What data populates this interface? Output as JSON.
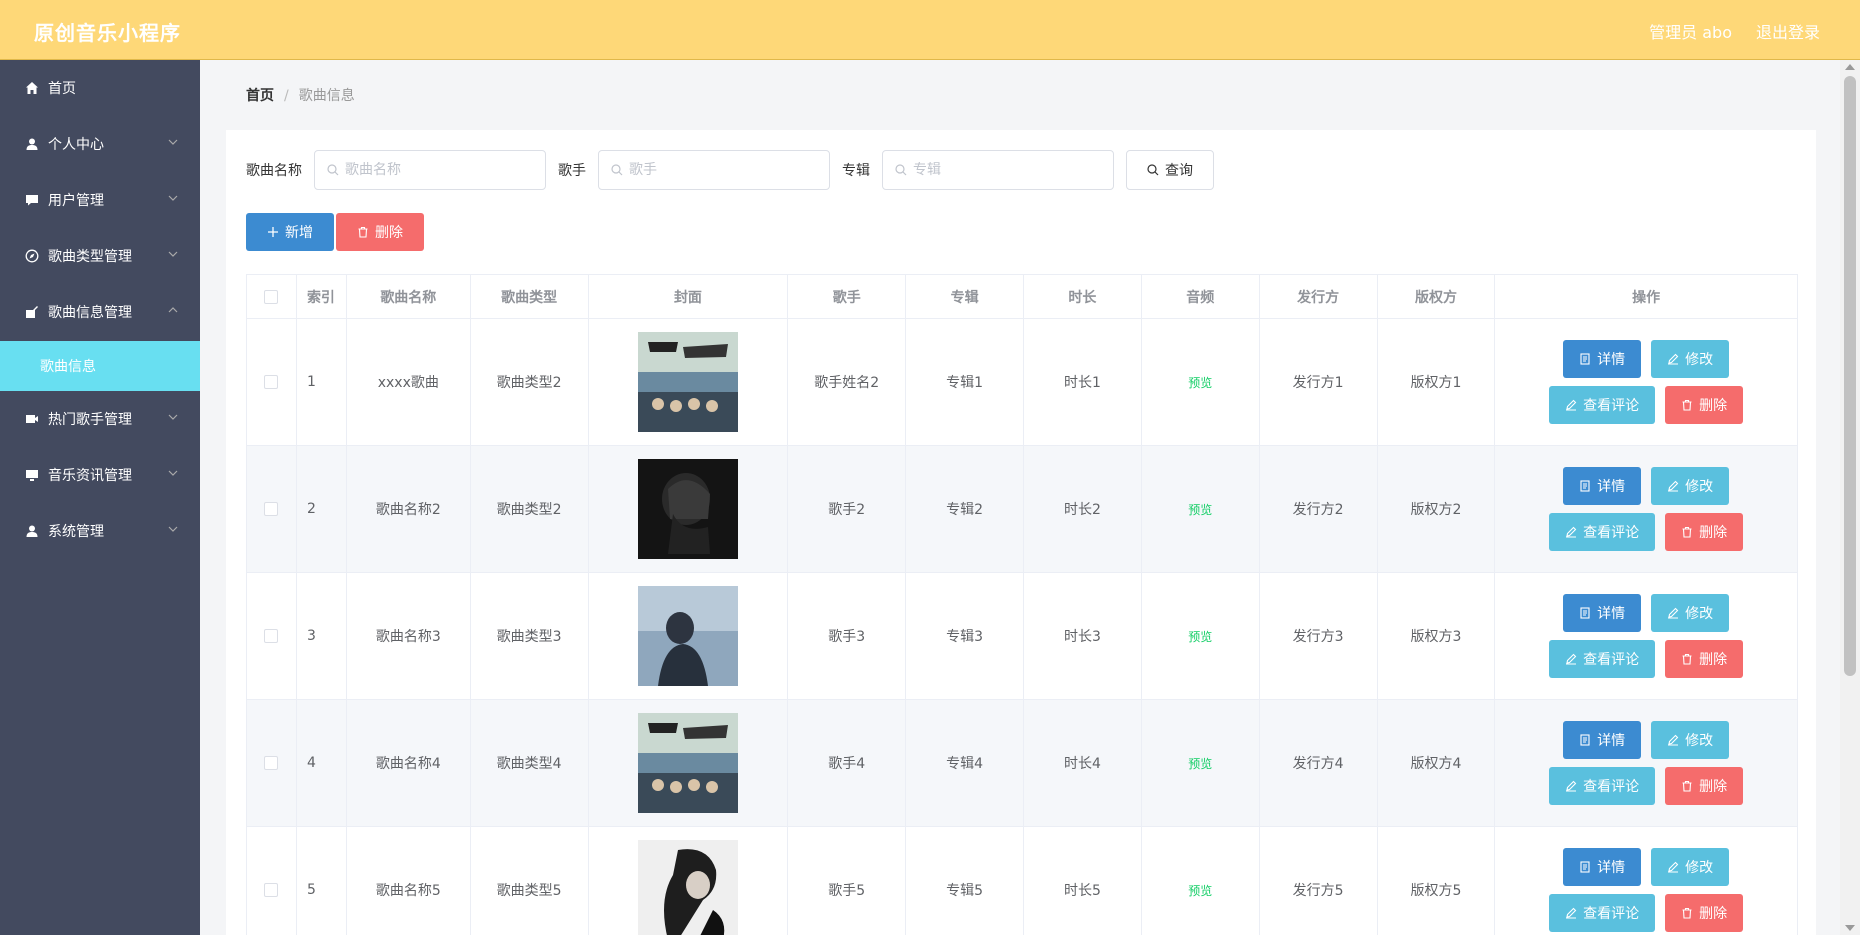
{
  "header": {
    "brand": "原创音乐小程序",
    "admin_label": "管理员 abo",
    "logout_label": "退出登录"
  },
  "sidebar": {
    "items": [
      {
        "label": "首页",
        "icon": "home-icon",
        "expandable": false
      },
      {
        "label": "个人中心",
        "icon": "user-icon",
        "expandable": true
      },
      {
        "label": "用户管理",
        "icon": "chat-icon",
        "expandable": true
      },
      {
        "label": "歌曲类型管理",
        "icon": "compass-icon",
        "expandable": true
      },
      {
        "label": "歌曲信息管理",
        "icon": "edit-icon",
        "expandable": true,
        "expanded": true
      },
      {
        "label": "热门歌手管理",
        "icon": "video-icon",
        "expandable": true
      },
      {
        "label": "音乐资讯管理",
        "icon": "monitor-icon",
        "expandable": true
      },
      {
        "label": "系统管理",
        "icon": "user-icon",
        "expandable": true
      }
    ],
    "active_sub": "歌曲信息"
  },
  "breadcrumb": {
    "home": "首页",
    "sep": "/",
    "current": "歌曲信息"
  },
  "search": {
    "name_label": "歌曲名称",
    "name_placeholder": "歌曲名称",
    "singer_label": "歌手",
    "singer_placeholder": "歌手",
    "album_label": "专辑",
    "album_placeholder": "专辑",
    "query_label": "查询"
  },
  "actions": {
    "add_label": "新增",
    "delete_label": "删除"
  },
  "table": {
    "headers": [
      "索引",
      "歌曲名称",
      "歌曲类型",
      "封面",
      "歌手",
      "专辑",
      "时长",
      "音频",
      "发行方",
      "版权方",
      "操作"
    ],
    "rows": [
      {
        "idx": "1",
        "name": "xxxx歌曲",
        "type": "歌曲类型2",
        "singer": "歌手姓名2",
        "album": "专辑1",
        "duration": "时长1",
        "audio": "预览",
        "publisher": "发行方1",
        "copyright": "版权方1"
      },
      {
        "idx": "2",
        "name": "歌曲名称2",
        "type": "歌曲类型2",
        "singer": "歌手2",
        "album": "专辑2",
        "duration": "时长2",
        "audio": "预览",
        "publisher": "发行方2",
        "copyright": "版权方2"
      },
      {
        "idx": "3",
        "name": "歌曲名称3",
        "type": "歌曲类型3",
        "singer": "歌手3",
        "album": "专辑3",
        "duration": "时长3",
        "audio": "预览",
        "publisher": "发行方3",
        "copyright": "版权方3"
      },
      {
        "idx": "4",
        "name": "歌曲名称4",
        "type": "歌曲类型4",
        "singer": "歌手4",
        "album": "专辑4",
        "duration": "时长4",
        "audio": "预览",
        "publisher": "发行方4",
        "copyright": "版权方4"
      },
      {
        "idx": "5",
        "name": "歌曲名称5",
        "type": "歌曲类型5",
        "singer": "歌手5",
        "album": "专辑5",
        "duration": "时长5",
        "audio": "预览",
        "publisher": "发行方5",
        "copyright": "版权方5"
      }
    ],
    "ops": {
      "detail": "详情",
      "edit": "修改",
      "comments": "查看评论",
      "delete": "删除"
    }
  },
  "colors": {
    "header": "#fed878",
    "sidebar": "#434a5f",
    "active_sub": "#68dff1",
    "primary": "#3c8bd1",
    "info": "#5ac0de",
    "danger": "#f56c6c",
    "success": "#13ce66"
  }
}
